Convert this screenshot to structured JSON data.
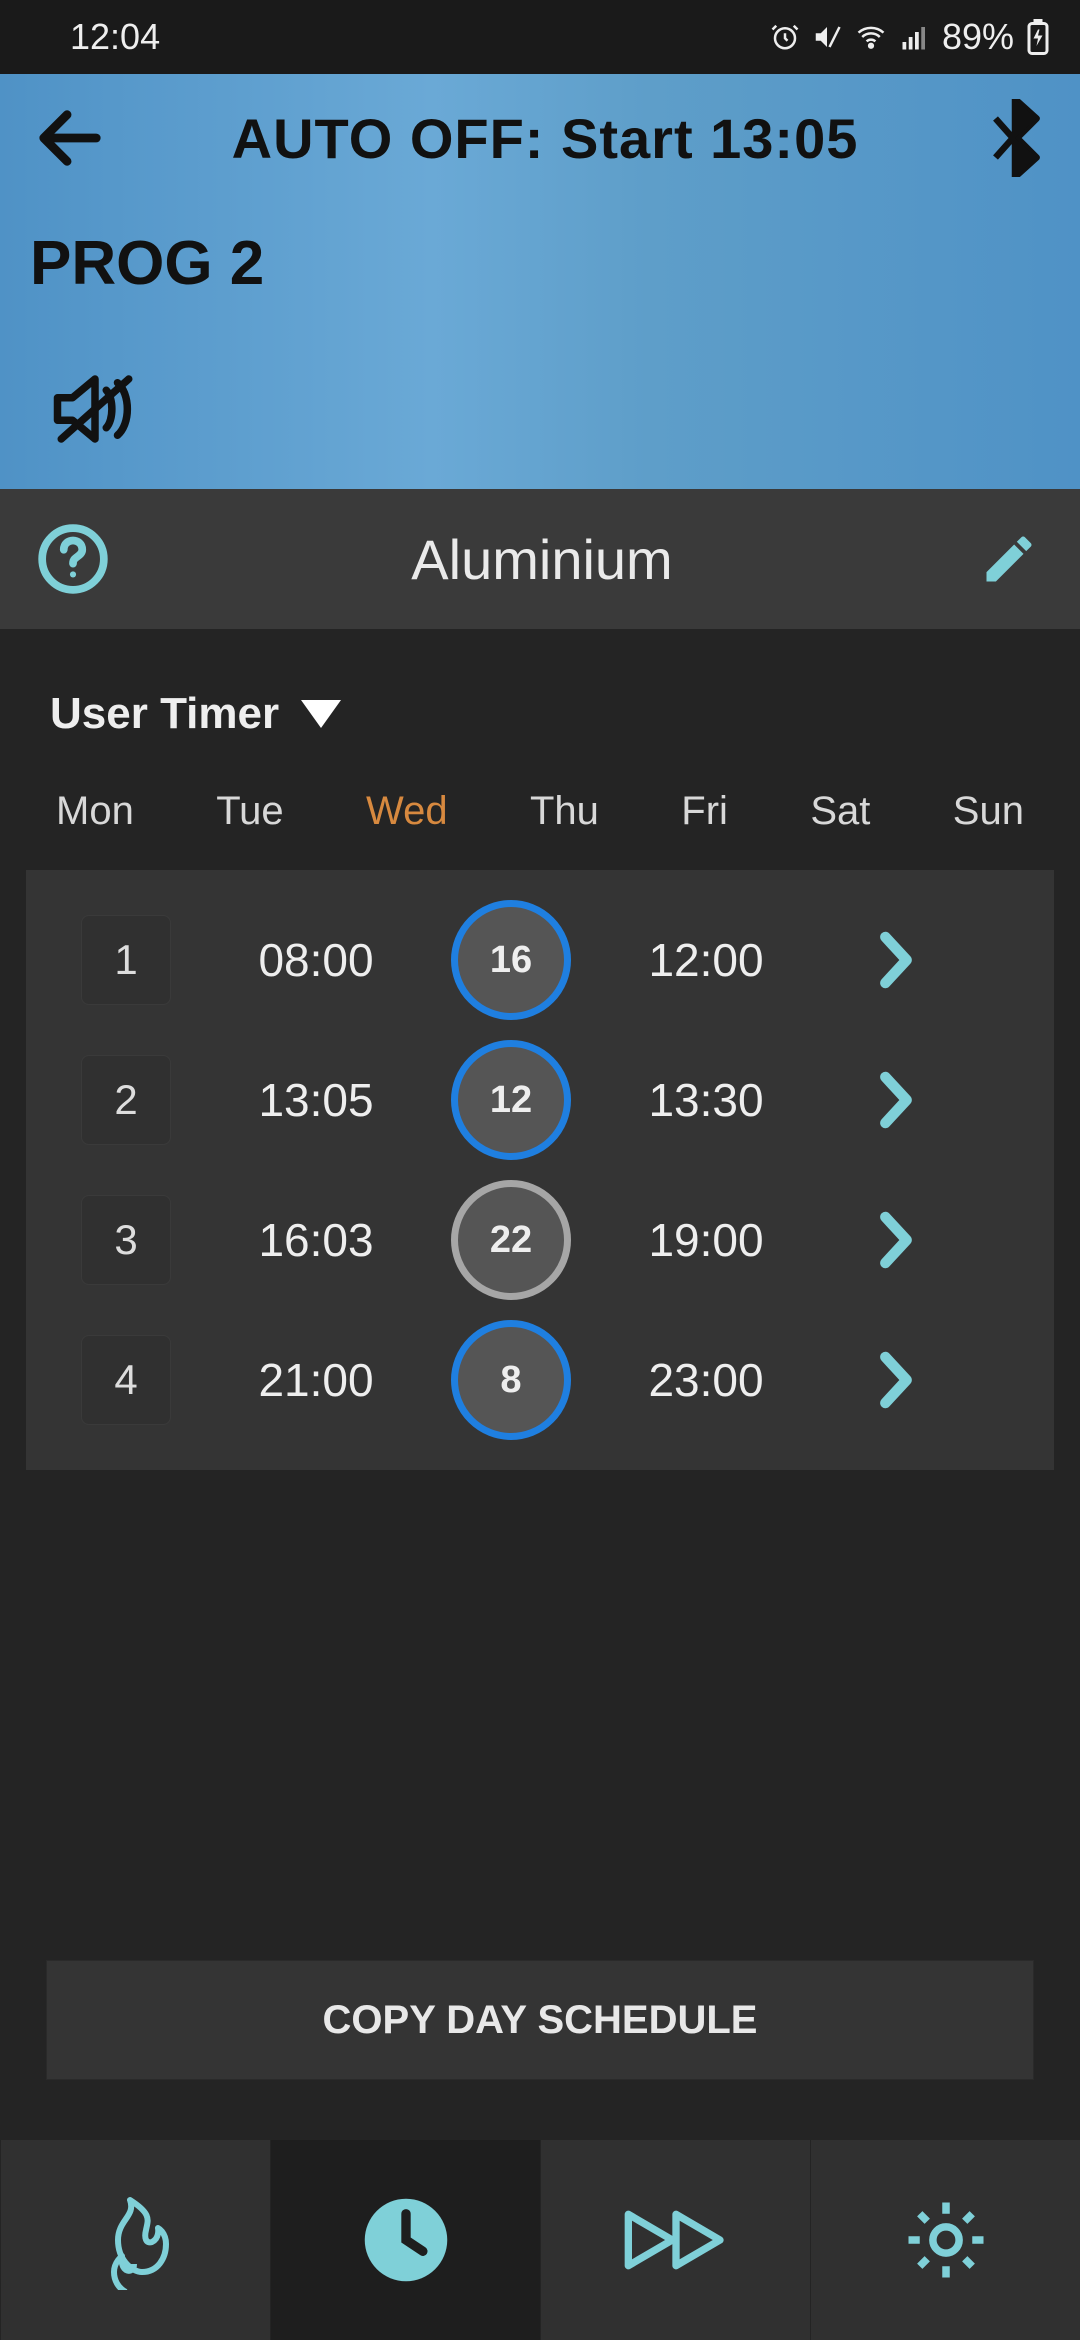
{
  "status": {
    "time": "12:04",
    "battery": "89%",
    "icons": [
      "alarm",
      "mute-vibrate",
      "wifi",
      "signal",
      "battery-charging"
    ]
  },
  "header": {
    "title": "AUTO OFF: Start 13:05",
    "program_label": "PROG 2"
  },
  "section": {
    "title": "Aluminium"
  },
  "dropdown": {
    "label": "User Timer"
  },
  "days": [
    {
      "label": "Mon",
      "active": false
    },
    {
      "label": "Tue",
      "active": false
    },
    {
      "label": "Wed",
      "active": true
    },
    {
      "label": "Thu",
      "active": false
    },
    {
      "label": "Fri",
      "active": false
    },
    {
      "label": "Sat",
      "active": false
    },
    {
      "label": "Sun",
      "active": false
    }
  ],
  "schedule": [
    {
      "index": "1",
      "start": "08:00",
      "temp": "16",
      "temp_ring": "blue",
      "end": "12:00"
    },
    {
      "index": "2",
      "start": "13:05",
      "temp": "12",
      "temp_ring": "blue",
      "end": "13:30"
    },
    {
      "index": "3",
      "start": "16:03",
      "temp": "22",
      "temp_ring": "grey",
      "end": "19:00"
    },
    {
      "index": "4",
      "start": "21:00",
      "temp": "8",
      "temp_ring": "blue",
      "end": "23:00"
    }
  ],
  "copy_button": "COPY DAY SCHEDULE",
  "nav": {
    "items": [
      "flame",
      "clock",
      "fast-forward",
      "settings"
    ],
    "active_index": 1
  },
  "colors": {
    "accent_cyan": "#7fd0d8",
    "accent_orange": "#d7893f",
    "ring_blue": "#1f7fe0"
  }
}
